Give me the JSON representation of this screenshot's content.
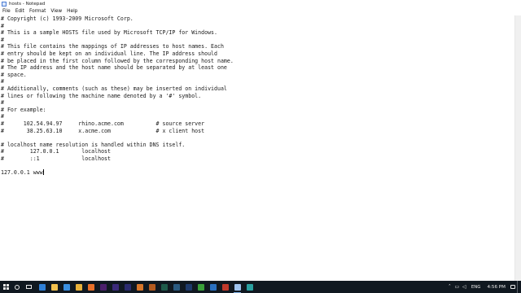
{
  "window": {
    "title": "hosts - Notepad"
  },
  "menubar": {
    "items": [
      "File",
      "Edit",
      "Format",
      "View",
      "Help"
    ]
  },
  "editor": {
    "lines": [
      "# Copyright (c) 1993-2009 Microsoft Corp.",
      "#",
      "# This is a sample HOSTS file used by Microsoft TCP/IP for Windows.",
      "#",
      "# This file contains the mappings of IP addresses to host names. Each",
      "# entry should be kept on an individual line. The IP address should",
      "# be placed in the first column followed by the corresponding host name.",
      "# The IP address and the host name should be separated by at least one",
      "# space.",
      "#",
      "# Additionally, comments (such as these) may be inserted on individual",
      "# lines or following the machine name denoted by a '#' symbol.",
      "#",
      "# For example:",
      "#",
      "#      102.54.94.97     rhino.acme.com          # source server",
      "#       38.25.63.10     x.acme.com              # x client host",
      "",
      "# localhost name resolution is handled within DNS itself.",
      "#\t127.0.0.1       localhost",
      "#\t::1             localhost",
      "",
      "127.0.0.1 www"
    ]
  },
  "taskbar": {
    "pinned_apps": [
      {
        "name": "edge-icon",
        "color": "#2f7fd6"
      },
      {
        "name": "file-explorer-icon",
        "color": "#f2c14e"
      },
      {
        "name": "store-icon",
        "color": "#3a8fe0"
      },
      {
        "name": "chrome-icon",
        "color": "#e8b13a"
      },
      {
        "name": "firefox-icon",
        "color": "#e8702a"
      },
      {
        "name": "premiere-icon",
        "color": "#4b1f6b"
      },
      {
        "name": "after-effects-icon",
        "color": "#3b2a7a"
      },
      {
        "name": "media-encoder-icon",
        "color": "#2b2b6e"
      },
      {
        "name": "app-icon-orange",
        "color": "#d8762a"
      },
      {
        "name": "illustrator-icon",
        "color": "#b35a1f"
      },
      {
        "name": "audition-icon",
        "color": "#1e5a4a"
      },
      {
        "name": "lightroom-icon",
        "color": "#2a5a80"
      },
      {
        "name": "photoshop-icon",
        "color": "#1e3a6a"
      },
      {
        "name": "app-icon-green",
        "color": "#3aa03a"
      },
      {
        "name": "app-icon-blue",
        "color": "#2a70c0"
      },
      {
        "name": "app-icon-red",
        "color": "#c0392b"
      },
      {
        "name": "notepad-icon",
        "color": "#9ec3ef"
      },
      {
        "name": "app-icon-teal",
        "color": "#2aa0a0"
      }
    ],
    "tray": {
      "language": "ENG",
      "time": "4:56 PM"
    }
  },
  "colors": {
    "taskbar_bg": "#101820",
    "active_indicator": "#7fb2e8"
  }
}
